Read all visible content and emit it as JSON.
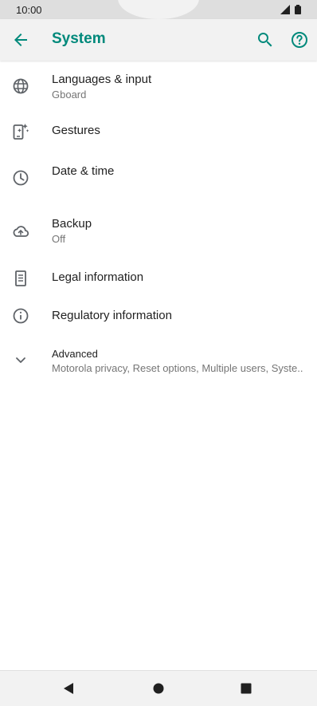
{
  "status_bar": {
    "time": "10:00",
    "icons": [
      "signal-icon",
      "battery-icon"
    ]
  },
  "app_bar": {
    "title": "System",
    "icons": [
      "back-arrow-icon",
      "search-icon",
      "help-icon"
    ]
  },
  "colors": {
    "accent": "#00897b",
    "text_primary": "#212121",
    "text_secondary": "#757575",
    "bar_background": "#f2f2f2"
  },
  "items": [
    {
      "title": "Languages & input",
      "subtitle": "Gboard",
      "icon": "globe-icon"
    },
    {
      "title": "Gestures",
      "subtitle": "",
      "icon": "gestures-phone-icon"
    },
    {
      "title": "Date & time",
      "subtitle": "",
      "icon": "clock-icon"
    },
    {
      "title": "Backup",
      "subtitle": "Off",
      "icon": "cloud-upload-icon"
    },
    {
      "title": "Legal information",
      "subtitle": "",
      "icon": "document-icon"
    },
    {
      "title": "Regulatory information",
      "subtitle": "",
      "icon": "info-icon"
    },
    {
      "title": "Advanced",
      "subtitle": "Motorola privacy, Reset options, Multiple users, Syste..",
      "icon": "chevron-down-icon"
    }
  ],
  "nav_bar": {
    "icons": [
      "back-triangle-icon",
      "home-circle-icon",
      "recents-square-icon"
    ]
  }
}
